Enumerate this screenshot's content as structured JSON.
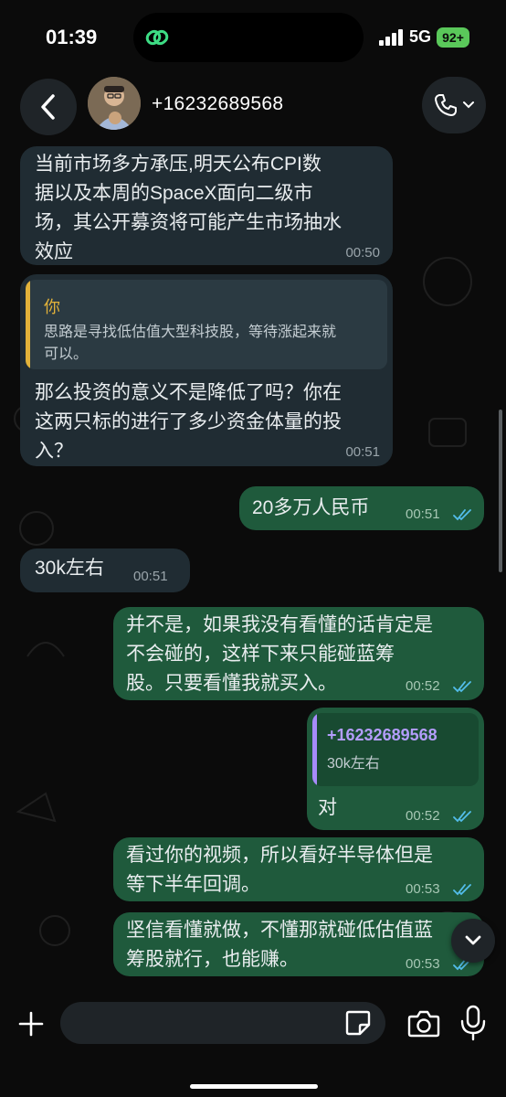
{
  "status_bar": {
    "time": "01:39",
    "network": "5G",
    "battery": "92+"
  },
  "header": {
    "contact": "+16232689568"
  },
  "messages": [
    {
      "text": "当前市场多方承压,明天公布CPI数\n据以及本周的SpaceX面向二级市\n场，其公开募资将可能产生市场抽水\n效应",
      "time": "00:50"
    },
    {
      "quote_author": "你",
      "quote_text": "思路是寻找低估值大型科技股，等待涨起来就\n可以。",
      "text": "那么投资的意义不是降低了吗？你在\n这两只标的进行了多少资金体量的投\n入？",
      "time": "00:51"
    },
    {
      "text": "20多万人民币",
      "time": "00:51"
    },
    {
      "text": "30k左右",
      "time": "00:51"
    },
    {
      "text": "并不是，如果我没有看懂的话肯定是\n不会碰的，这样下来只能碰蓝筹\n股。只要看懂我就买入。",
      "time": "00:52"
    },
    {
      "quote_author": "+16232689568",
      "quote_text": "30k左右",
      "text": "对",
      "time": "00:52"
    },
    {
      "text": "看过你的视频，所以看好半导体但是\n等下半年回调。",
      "time": "00:53"
    },
    {
      "text": "坚信看懂就做，不懂那就碰低估值蓝\n筹股就行，也能赚。",
      "time": "00:53"
    }
  ],
  "colors": {
    "incoming": "#202c33",
    "outgoing": "#1f5a3c",
    "read_ticks": "#53bdeb",
    "quote_you": "#e2b23a",
    "quote_contact": "#a78bfa"
  },
  "icons": [
    "back-chevron-icon",
    "phone-icon",
    "chevron-down-icon",
    "plus-icon",
    "sticker-icon",
    "camera-icon",
    "microphone-icon"
  ]
}
